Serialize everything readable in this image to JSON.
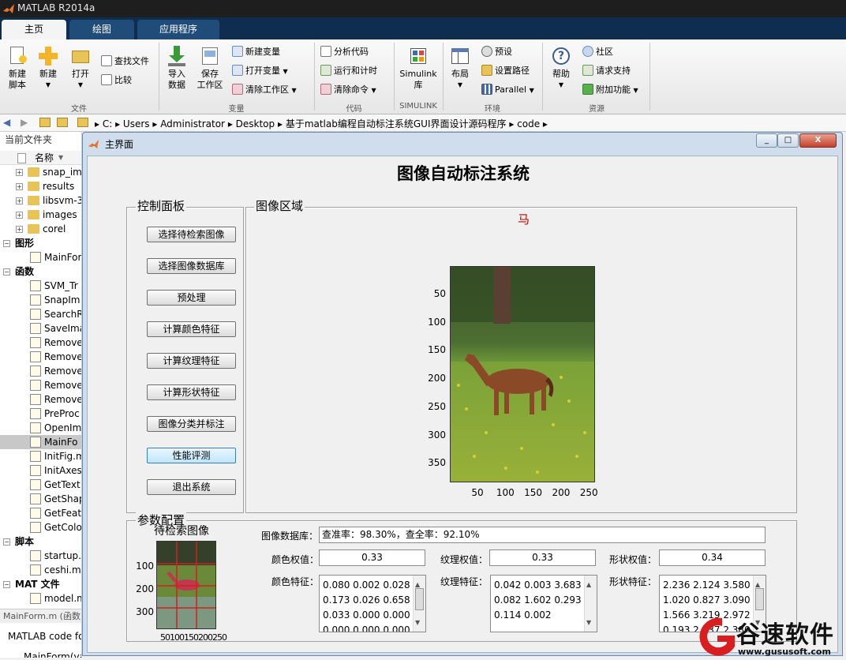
{
  "app": {
    "title": "MATLAB R2014a"
  },
  "tabs": [
    {
      "label": "主页"
    },
    {
      "label": "绘图"
    },
    {
      "label": "应用程序"
    }
  ],
  "ribbon": {
    "file": {
      "new_script": "新建\n脚本",
      "new": "新建",
      "open": "打开",
      "find_files": "查找文件",
      "compare": "比较",
      "group": "文件"
    },
    "variable": {
      "import": "导入\n数据",
      "save": "保存\n工作区",
      "new_var": "新建变量",
      "open_var": "打开变量",
      "clear_ws": "清除工作区",
      "group": "变量"
    },
    "code": {
      "analyze": "分析代码",
      "run_time": "运行和计时",
      "clear_cmd": "清除命令",
      "group": "代码"
    },
    "simulink": {
      "lib": "Simulink\n库",
      "group": "SIMULINK"
    },
    "env": {
      "layout": "布局",
      "prefs": "预设",
      "set_path": "设置路径",
      "parallel": "Parallel",
      "group": "环境"
    },
    "res": {
      "help": "帮助",
      "community": "社区",
      "support": "请求支持",
      "addons": "附加功能",
      "group": "资源"
    }
  },
  "address": {
    "crumbs": [
      "C:",
      "Users",
      "Administrator",
      "Desktop",
      "基于matlab编程自动标注系统GUI界面设计源码程序",
      "code"
    ]
  },
  "left_panel": {
    "header": "当前文件夹",
    "col": "名称",
    "folders": [
      "snap_im",
      "results",
      "libsvm-3",
      "images",
      "corel"
    ],
    "sections": {
      "fig": "图形",
      "func": "函数",
      "script": "脚本",
      "mat": "MAT 文件"
    },
    "fig_files": [
      "MainFor"
    ],
    "func_files": [
      "SVM_Tr",
      "SnapIm",
      "SearchR",
      "SaveIma",
      "Remove",
      "Remove",
      "Remove",
      "Remove",
      "Remove",
      "PreProc",
      "OpenIm",
      "MainFo",
      "InitFig.m",
      "InitAxes",
      "GetText",
      "GetShap",
      "GetFeat",
      "GetColo"
    ],
    "script_files": [
      "startup.",
      "ceshi.m"
    ],
    "mat_files": [
      "model.m"
    ],
    "detail_title": "MainForm.m (函数",
    "detail_desc": "MATLAB code fo",
    "detail_item": "MainForm(va"
  },
  "window": {
    "title": "主界面",
    "min": "_",
    "max": "□",
    "close": "X"
  },
  "gui": {
    "heading": "图像自动标注系统",
    "control_panel": "控制面板",
    "image_panel": "图像区域",
    "param_panel": "参数配置",
    "buttons": [
      "选择待检索图像",
      "选择图像数据库",
      "预处理",
      "计算颜色特征",
      "计算纹理特征",
      "计算形状特征",
      "图像分类并标注",
      "性能评测",
      "退出系统"
    ],
    "result_label": "马",
    "main_axes": {
      "yticks": [
        "50",
        "100",
        "150",
        "200",
        "250",
        "300",
        "350"
      ],
      "xticks": [
        "50",
        "100",
        "150",
        "200",
        "250"
      ]
    },
    "thumb": {
      "title": "待检索图像",
      "yticks": [
        "100",
        "200",
        "300"
      ],
      "xticks": "50100150200250"
    },
    "db_label": "图像数据库：",
    "db_value": "查准率：98.30%，查全率：92.10%",
    "weights": [
      {
        "label": "颜色权值：",
        "value": "0.33"
      },
      {
        "label": "纹理权值：",
        "value": "0.33"
      },
      {
        "label": "形状权值：",
        "value": "0.34"
      }
    ],
    "features": [
      {
        "label": "颜色特征：",
        "lines": [
          "0.080 0.002 0.028",
          "0.173 0.026 0.658",
          "0.033 0.000 0.000",
          "0.000 0.000 0.000"
        ]
      },
      {
        "label": "纹理特征：",
        "lines": [
          "0.042 0.003 3.683",
          "0.082 1.602 0.293",
          "0.114 0.002"
        ]
      },
      {
        "label": "形状特征：",
        "lines": [
          "2.236 2.124 3.580",
          "1.020 0.827 3.090",
          "1.566 3.219 2.972",
          "0.193 2.537 2.380"
        ]
      }
    ]
  },
  "watermark": {
    "brand": "谷速软件",
    "url": "www.gususoft.com"
  }
}
